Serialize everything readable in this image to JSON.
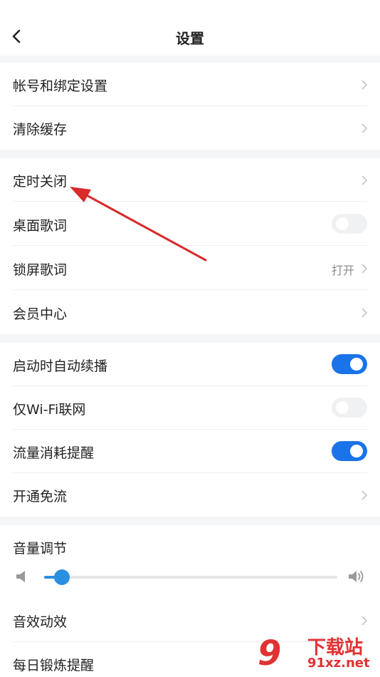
{
  "header": {
    "title": "设置"
  },
  "sections": {
    "account": [
      {
        "label": "帐号和绑定设置"
      },
      {
        "label": "清除缓存"
      }
    ],
    "playback": [
      {
        "label": "定时关闭"
      },
      {
        "label": "桌面歌词"
      },
      {
        "label": "锁屏歌词",
        "value": "打开"
      },
      {
        "label": "会员中心"
      }
    ],
    "network": [
      {
        "label": "启动时自动续播"
      },
      {
        "label": "仅Wi-Fi联网"
      },
      {
        "label": "流量消耗提醒"
      },
      {
        "label": "开通免流"
      }
    ],
    "audio": {
      "volume_label": "音量调节",
      "volume_level": 0.06,
      "rows": [
        {
          "label": "音效动效"
        },
        {
          "label": "每日锻炼提醒"
        }
      ]
    }
  },
  "toggles": {
    "desktop_lyrics": false,
    "auto_resume": true,
    "wifi_only": false,
    "data_alert": true
  },
  "watermark": {
    "brand_num": "9",
    "brand_cn": "下载站",
    "brand_url": "91xz.net"
  },
  "colors": {
    "accent": "#1a73e8",
    "arrow": "#d92b2b",
    "watermark": "#e03232"
  }
}
